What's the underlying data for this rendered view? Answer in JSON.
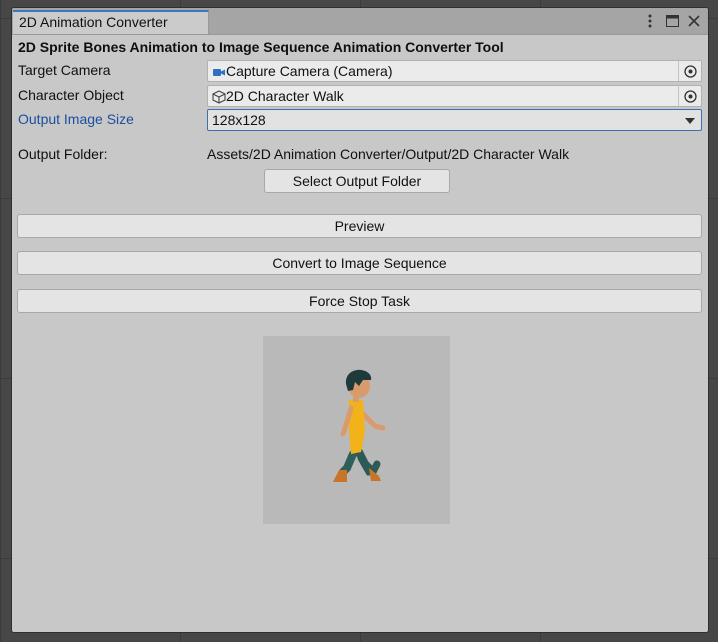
{
  "window": {
    "tab_title": "2D Animation Converter",
    "menu_icon": "kebab-menu-icon",
    "maximize_icon": "maximize-icon",
    "close_icon": "close-icon"
  },
  "tool": {
    "title": "2D Sprite Bones Animation to Image Sequence Animation Converter Tool"
  },
  "fields": {
    "target_camera": {
      "label": "Target Camera",
      "value": "Capture Camera (Camera)",
      "icon": "camera-icon"
    },
    "character_object": {
      "label": "Character Object",
      "value": "2D Character Walk",
      "icon": "cube-icon"
    },
    "output_image_size": {
      "label": "Output Image Size",
      "value": "128x128"
    }
  },
  "output": {
    "label": "Output Folder:",
    "path": "Assets/2D Animation Converter/Output/2D Character Walk",
    "select_button": "Select Output Folder"
  },
  "buttons": {
    "preview": "Preview",
    "convert": "Convert to Image Sequence",
    "force_stop": "Force Stop Task"
  },
  "colors": {
    "accent": "#3a79bb",
    "focused_label": "#1a4fa0",
    "shirt": "#f2b21a",
    "pants": "#2d5a55",
    "shoes": "#c8752a",
    "hair": "#1e3a3a",
    "skin": "#d99b6c"
  }
}
